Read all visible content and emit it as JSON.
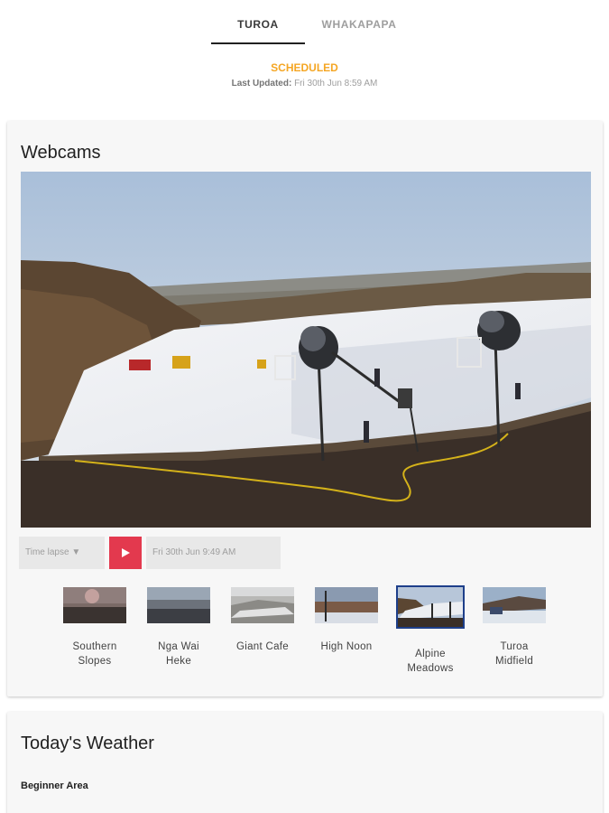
{
  "tabs": [
    {
      "label": "TUROA",
      "active": true
    },
    {
      "label": "WHAKAPAPA",
      "active": false
    }
  ],
  "status": {
    "label": "SCHEDULED",
    "color": "#f5a623",
    "updated_label": "Last Updated:",
    "updated_value": "Fri 30th Jun 8:59 AM"
  },
  "webcams": {
    "title": "Webcams",
    "controls": {
      "timelapse_label": "Time lapse ▼",
      "play_icon": "play-icon",
      "play_color": "#e3394e",
      "datetime": "Fri 30th Jun 9:49 AM"
    },
    "cameras": [
      {
        "line1": "Southern",
        "line2": "Slopes",
        "selected": false
      },
      {
        "line1": "Nga Wai",
        "line2": "Heke",
        "selected": false
      },
      {
        "line1": "Giant Cafe",
        "line2": "",
        "selected": false
      },
      {
        "line1": "High Noon",
        "line2": "",
        "selected": false
      },
      {
        "line1": "Alpine",
        "line2": "Meadows",
        "selected": true
      },
      {
        "line1": "Turoa",
        "line2": "Midfield",
        "selected": false
      }
    ]
  },
  "weather": {
    "title": "Today's Weather",
    "section": "Beginner Area"
  }
}
